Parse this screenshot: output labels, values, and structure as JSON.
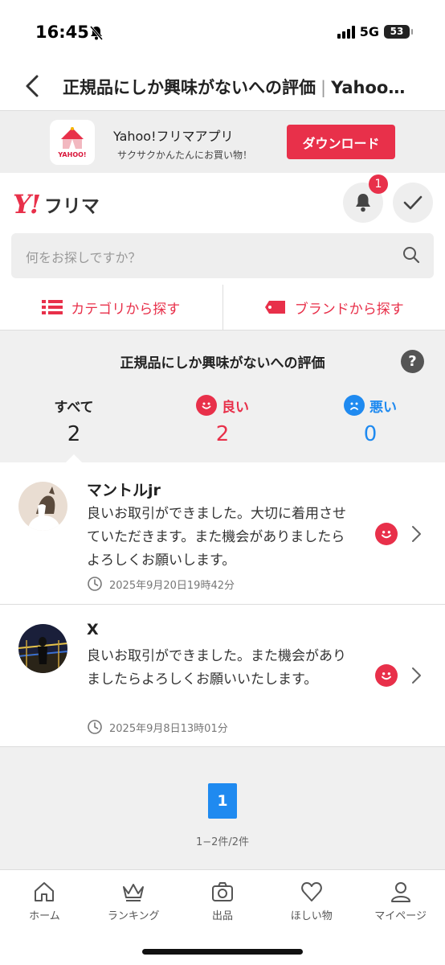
{
  "status": {
    "time": "16:45",
    "network": "5G",
    "battery": "53"
  },
  "nav": {
    "title": "正規品にしか興味がないへの評価",
    "separator": "|",
    "site": "Yahoo…"
  },
  "banner": {
    "app_name": "Yahoo!フリマアプリ",
    "tagline": "サクサクかんたんにお買い物！",
    "download_label": "ダウンロード",
    "icon_text": "YAHOO!"
  },
  "header": {
    "logo_mark": "Y!",
    "logo_text": "フリマ",
    "notification_count": "1"
  },
  "search": {
    "placeholder": "何をお探しですか？"
  },
  "categories": {
    "category_label": "カテゴリから探す",
    "brand_label": "ブランドから探す"
  },
  "summary": {
    "title": "正規品にしか興味がないへの評価",
    "help": "?",
    "all_label": "すべて",
    "all_count": "2",
    "good_label": "良い",
    "good_count": "2",
    "bad_label": "悪い",
    "bad_count": "0"
  },
  "reviews": [
    {
      "name": "マントルjr",
      "text": "良いお取引ができました。大切に着用させていただきます。また機会がありましたらよろしくお願いします。",
      "date": "2025年9月20日19時42分",
      "rating": "good"
    },
    {
      "name": "X",
      "text": "良いお取引ができました。また機会がありましたらよろしくお願いいたします。",
      "date": "2025年9月8日13時01分",
      "rating": "good"
    }
  ],
  "pagination": {
    "current_page": "1",
    "info": "1−2件/2件"
  },
  "tabs": [
    {
      "label": "ホーム",
      "icon": "home-icon"
    },
    {
      "label": "ランキング",
      "icon": "crown-icon"
    },
    {
      "label": "出品",
      "icon": "camera-icon"
    },
    {
      "label": "ほしい物",
      "icon": "heart-icon"
    },
    {
      "label": "マイページ",
      "icon": "person-icon"
    }
  ],
  "colors": {
    "accent": "#e8304a",
    "good": "#e8304a",
    "bad": "#1f8af0",
    "page_active": "#1f8af0"
  }
}
